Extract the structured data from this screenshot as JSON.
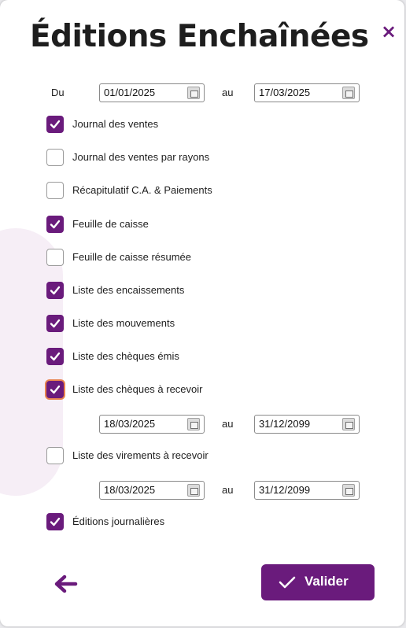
{
  "dialog": {
    "title": "Éditions Enchaînées",
    "close_icon": "×",
    "validate_label": "Valider",
    "accent_color": "#6a1b7c"
  },
  "range": {
    "from_label": "Du",
    "from_value": "01/01/2025",
    "to_label": "au",
    "to_value": "17/03/2025"
  },
  "options": [
    {
      "label": "Journal des ventes",
      "checked": true
    },
    {
      "label": "Journal des ventes par rayons",
      "checked": false
    },
    {
      "label": "Récapitulatif C.A. & Paiements",
      "checked": false
    },
    {
      "label": "Feuille de caisse",
      "checked": true
    },
    {
      "label": "Feuille de caisse résumée",
      "checked": false
    },
    {
      "label": "Liste des encaissements",
      "checked": true
    },
    {
      "label": "Liste des mouvements",
      "checked": true
    },
    {
      "label": "Liste des chèques émis",
      "checked": true
    },
    {
      "label": "Liste des chèques à recevoir",
      "checked": true
    },
    {
      "label": "Liste des virements à recevoir",
      "checked": false
    },
    {
      "label": "Éditions journalières",
      "checked": true
    }
  ],
  "cheques_range": {
    "from_value": "18/03/2025",
    "to_label": "au",
    "to_value": "31/12/2099"
  },
  "virements_range": {
    "from_value": "18/03/2025",
    "to_label": "au",
    "to_value": "31/12/2099"
  }
}
